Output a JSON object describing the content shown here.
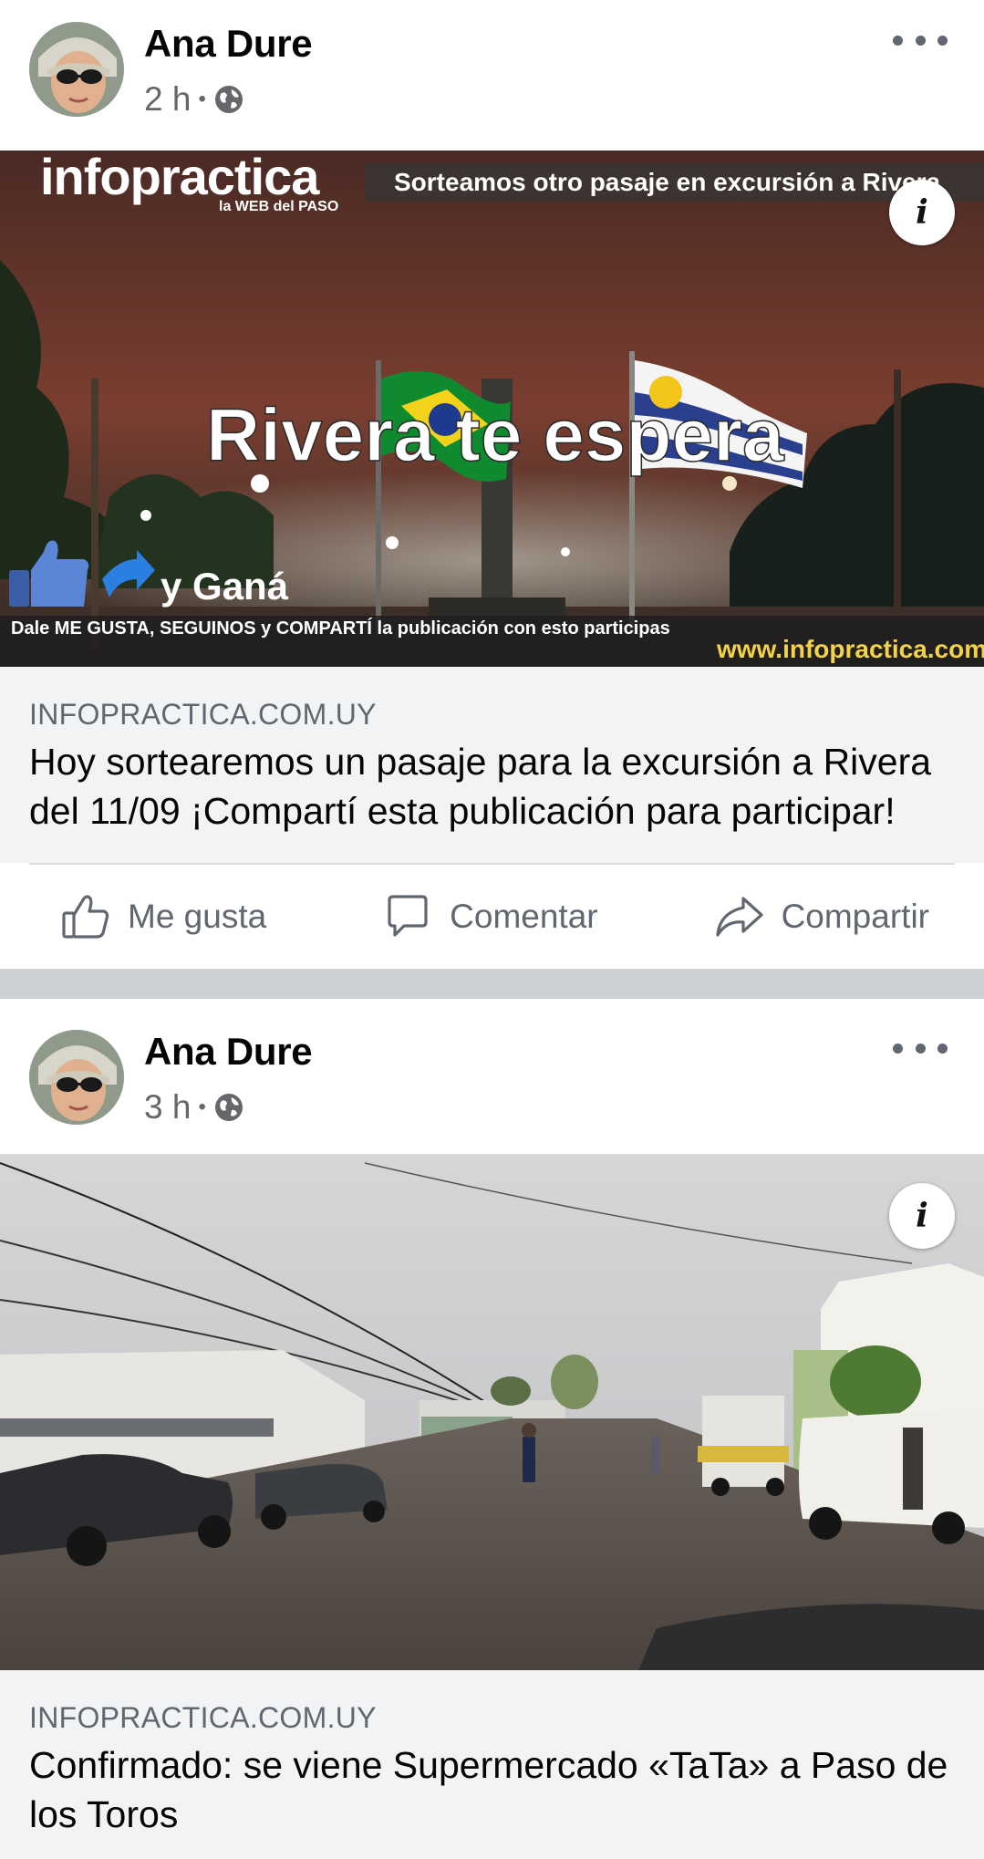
{
  "posts": [
    {
      "author": "Ana Dure",
      "time": "2 h",
      "separator": "•",
      "privacy_icon": "globe-icon",
      "image": {
        "brand": "infopractica",
        "brand_tagline": "la WEB del PASO",
        "banner": "Sorteamos otro pasaje en excursión a Rivera",
        "headline": "Rivera te espera",
        "cta": "y Ganá",
        "instructions": "Dale ME GUSTA, SEGUINOS y COMPARTÍ  la publicación con esto participas",
        "url": "www.infopractica.com.uy"
      },
      "link": {
        "domain": "INFOPRACTICA.COM.UY",
        "title": "Hoy sortearemos un pasaje para la excursión a Rivera del 11/09 ¡Compartí esta publicación para participar!"
      }
    },
    {
      "author": "Ana Dure",
      "time": "3 h",
      "separator": "•",
      "privacy_icon": "globe-icon",
      "link": {
        "domain": "INFOPRACTICA.COM.UY",
        "title": "Confirmado: se viene Supermercado «TaTa» a Paso de los Toros"
      }
    }
  ],
  "actions": {
    "like": "Me gusta",
    "comment": "Comentar",
    "share": "Compartir"
  },
  "colors": {
    "secondary_text": "#65676b",
    "link_box_bg": "#f2f3f5",
    "feed_gap": "#ccd0d5"
  }
}
